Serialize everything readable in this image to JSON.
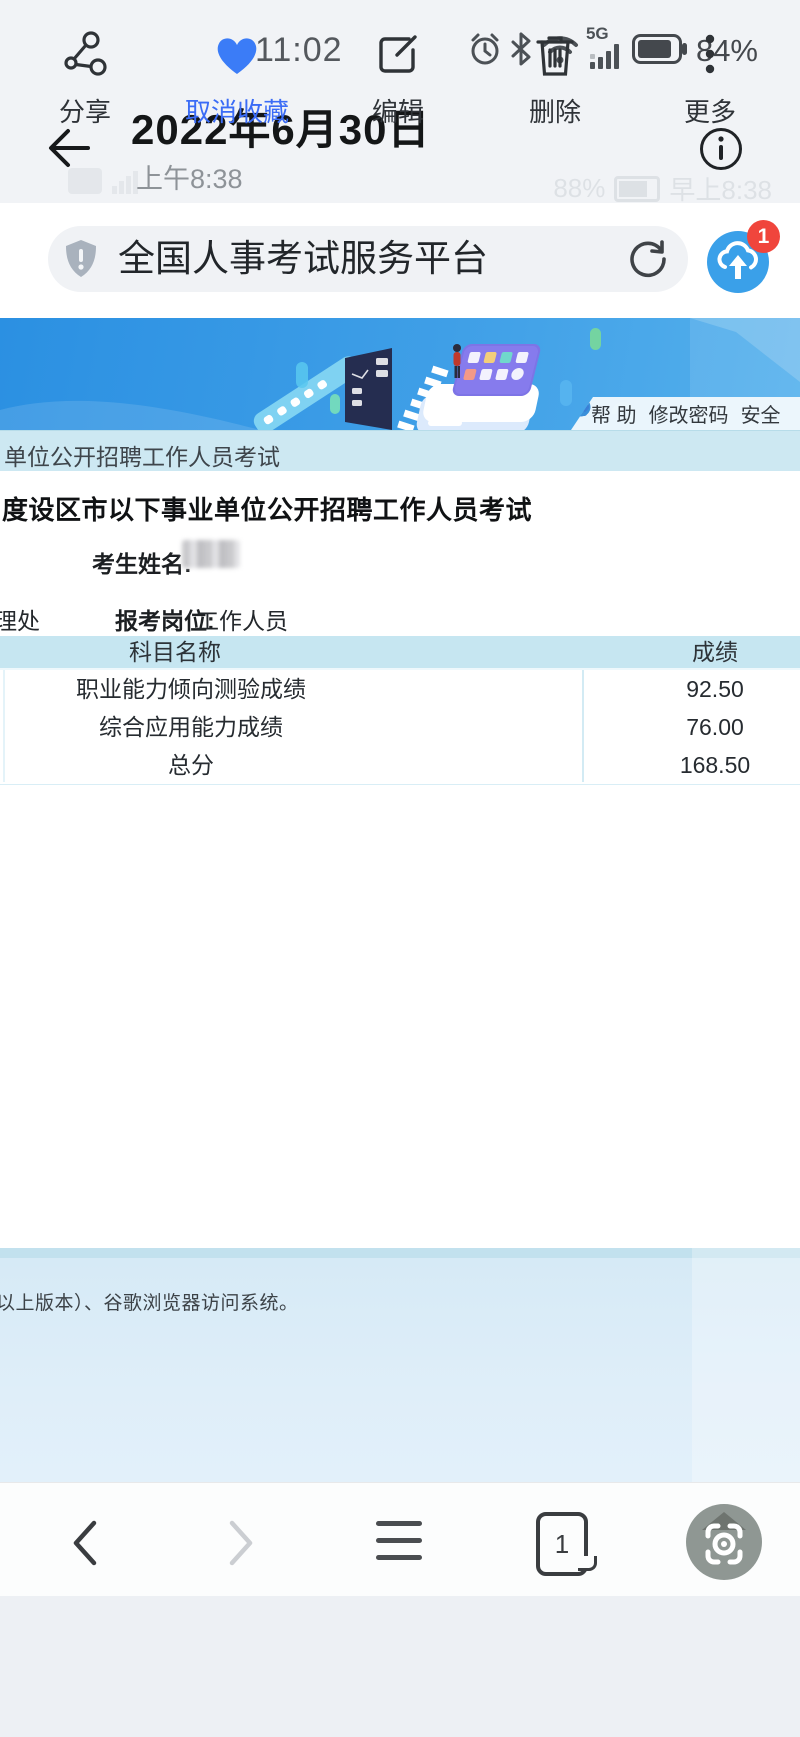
{
  "status_bar": {
    "time": "11:02",
    "network_label": "5G",
    "battery_percent": "84%"
  },
  "header": {
    "title": "2022年6月30日",
    "subtitle": "上午8:38",
    "ghost_battery_percent": "88%",
    "ghost_time": "早上8:38"
  },
  "browser": {
    "url_text": "全国人事考试服务平台",
    "upload_badge": "1",
    "tabs_count": "1"
  },
  "banner_links": {
    "help": "帮 助",
    "change_password": "修改密码",
    "logout": "安全"
  },
  "breadcrumb": "单位公开招聘工作人员考试",
  "page": {
    "title": "度设区市以下事业单位公开招聘工作人员考试",
    "candidate_label": "考生姓名:",
    "dept_fragment": "理处",
    "position_label": "报考岗位:",
    "position_value": "工作人员"
  },
  "score_table": {
    "headers": [
      "科目名称",
      "成绩"
    ],
    "rows": [
      [
        "职业能力倾向测验成绩",
        "92.50"
      ],
      [
        "综合应用能力成绩",
        "76.00"
      ],
      [
        "总分",
        "168.50"
      ]
    ]
  },
  "footer_note": "以上版本）、谷歌浏览器访问系统。",
  "action_bar": {
    "items": [
      {
        "label": "分享"
      },
      {
        "label": "取消收藏"
      },
      {
        "label": "编辑"
      },
      {
        "label": "删除"
      },
      {
        "label": "更多"
      }
    ]
  },
  "icons": [
    "alarm-icon",
    "bluetooth-icon",
    "wifi-icon",
    "signal-bars-icon",
    "battery-icon",
    "back-arrow-icon",
    "info-icon",
    "shield-icon",
    "refresh-icon",
    "cloud-upload-icon",
    "lock-icon",
    "question-icon",
    "exit-icon",
    "chevron-left-icon",
    "chevron-right-icon",
    "menu-icon",
    "tabs-icon",
    "lens-icon",
    "share-icon",
    "heart-icon",
    "edit-icon",
    "delete-icon",
    "more-icon"
  ],
  "colors": {
    "accent_blue": "#3b6cf6",
    "banner_blue": "#2b90e2",
    "badge_red": "#f0453c",
    "table_header_bg": "#c6e6f1",
    "footer_bg": "#d6eaf6"
  }
}
